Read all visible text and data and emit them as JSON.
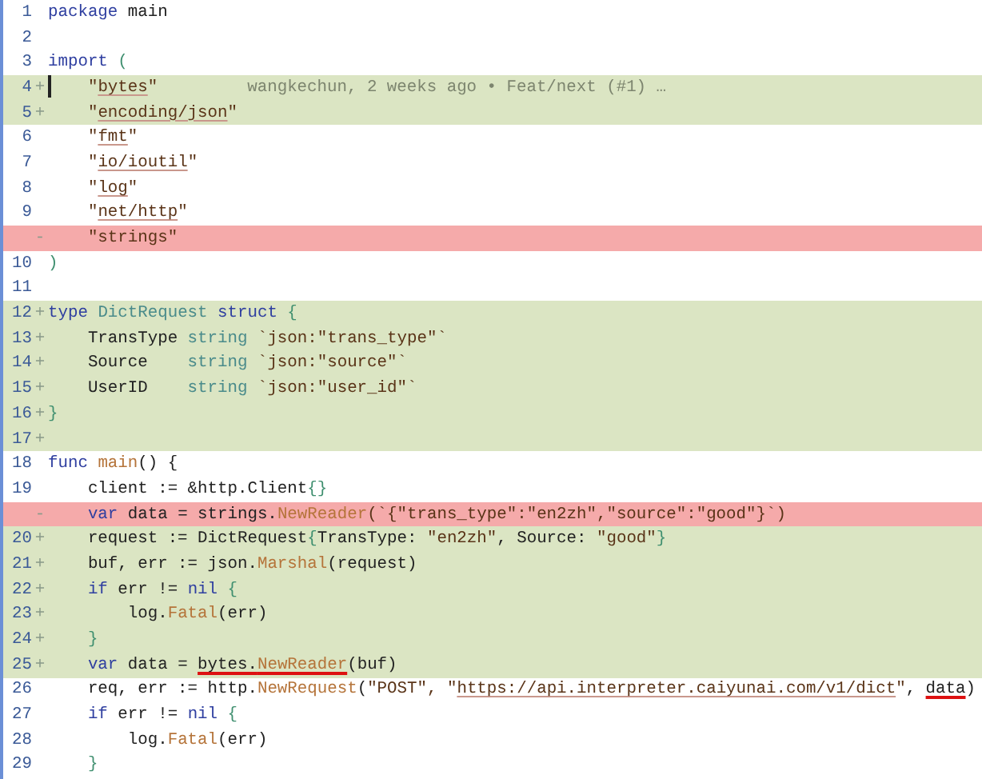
{
  "lines": [
    {
      "number": "1",
      "added": false,
      "removed": false,
      "code": [
        {
          "text": "package",
          "kind": "keyword"
        },
        {
          "text": " main",
          "kind": "plain"
        }
      ]
    },
    {
      "number": "2",
      "added": false,
      "removed": false
    },
    {
      "number": "3",
      "added": false,
      "removed": false,
      "code": [
        {
          "text": "import",
          "kind": "keyword"
        },
        {
          "text": " (",
          "kind": "punct"
        }
      ]
    },
    {
      "number": "4",
      "marker": "+",
      "added": true,
      "removed": false,
      "cursor": true,
      "code": [
        {
          "text": "    \"",
          "kind": "string"
        },
        {
          "text": "bytes",
          "kind": "link"
        },
        {
          "text": "\"",
          "kind": "string"
        }
      ],
      "blame": "wangkechun, 2 weeks ago • Feat/next (#1) …"
    },
    {
      "number": "5",
      "marker": "+",
      "added": true,
      "removed": false,
      "code": [
        {
          "text": "    \"",
          "kind": "string"
        },
        {
          "text": "encoding/json",
          "kind": "link"
        },
        {
          "text": "\"",
          "kind": "string"
        }
      ]
    },
    {
      "number": "6",
      "added": false,
      "removed": false,
      "code": [
        {
          "text": "    \"",
          "kind": "string"
        },
        {
          "text": "fmt",
          "kind": "link"
        },
        {
          "text": "\"",
          "kind": "string"
        }
      ]
    },
    {
      "number": "7",
      "added": false,
      "removed": false,
      "code": [
        {
          "text": "    \"",
          "kind": "string"
        },
        {
          "text": "io/ioutil",
          "kind": "link"
        },
        {
          "text": "\"",
          "kind": "string"
        }
      ]
    },
    {
      "number": "8",
      "added": false,
      "removed": false,
      "code": [
        {
          "text": "    \"",
          "kind": "string"
        },
        {
          "text": "log",
          "kind": "link"
        },
        {
          "text": "\"",
          "kind": "string"
        }
      ]
    },
    {
      "number": "9",
      "added": false,
      "removed": false,
      "code": [
        {
          "text": "    \"",
          "kind": "string"
        },
        {
          "text": "net/http",
          "kind": "link"
        },
        {
          "text": "\"",
          "kind": "string"
        }
      ]
    },
    {
      "marker": "-",
      "added": false,
      "removed": true,
      "code": [
        {
          "text": "    \"strings\"",
          "kind": "string"
        }
      ]
    },
    {
      "number": "10",
      "added": false,
      "removed": false,
      "code": [
        {
          "text": ")",
          "kind": "punct"
        }
      ]
    },
    {
      "number": "11",
      "added": false,
      "removed": false
    },
    {
      "number": "12",
      "marker": "+",
      "added": true,
      "removed": false,
      "code": [
        {
          "text": "type",
          "kind": "keyword"
        },
        {
          "text": " DictRequest",
          "kind": "type"
        },
        {
          "text": " struct",
          "kind": "keyword"
        },
        {
          "text": " {",
          "kind": "punct"
        }
      ]
    },
    {
      "number": "13",
      "marker": "+",
      "added": true,
      "removed": false,
      "code": [
        {
          "text": "    TransType ",
          "kind": "plain"
        },
        {
          "text": "string",
          "kind": "type"
        },
        {
          "text": " `json:\"trans_type\"`",
          "kind": "string"
        }
      ]
    },
    {
      "number": "14",
      "marker": "+",
      "added": true,
      "removed": false,
      "code": [
        {
          "text": "    Source    ",
          "kind": "plain"
        },
        {
          "text": "string",
          "kind": "type"
        },
        {
          "text": " `json:\"source\"`",
          "kind": "string"
        }
      ]
    },
    {
      "number": "15",
      "marker": "+",
      "added": true,
      "removed": false,
      "code": [
        {
          "text": "    UserID    ",
          "kind": "plain"
        },
        {
          "text": "string",
          "kind": "type"
        },
        {
          "text": " `json:\"user_id\"`",
          "kind": "string"
        }
      ]
    },
    {
      "number": "16",
      "marker": "+",
      "added": true,
      "removed": false,
      "code": [
        {
          "text": "}",
          "kind": "punct"
        }
      ]
    },
    {
      "number": "17",
      "marker": "+",
      "added": true,
      "removed": false
    },
    {
      "number": "18",
      "added": false,
      "removed": false,
      "code": [
        {
          "text": "func",
          "kind": "keyword"
        },
        {
          "text": " main",
          "kind": "func"
        },
        {
          "text": "() {",
          "kind": "plain"
        }
      ]
    },
    {
      "number": "19",
      "added": false,
      "removed": false,
      "code": [
        {
          "text": "    client := &http.Client",
          "kind": "plain"
        },
        {
          "text": "{}",
          "kind": "punct"
        }
      ]
    },
    {
      "marker": "-",
      "added": false,
      "removed": true,
      "code": [
        {
          "text": "    var",
          "kind": "keyword"
        },
        {
          "text": " data = strings.",
          "kind": "plain"
        },
        {
          "text": "NewReader",
          "kind": "func"
        },
        {
          "text": "(`{\"trans_type\":\"en2zh\",\"source\":\"good\"}`)",
          "kind": "string"
        }
      ]
    },
    {
      "number": "20",
      "marker": "+",
      "added": true,
      "removed": false,
      "code": [
        {
          "text": "    request := DictRequest",
          "kind": "plain"
        },
        {
          "text": "{",
          "kind": "punct"
        },
        {
          "text": "TransType: ",
          "kind": "plain"
        },
        {
          "text": "\"en2zh\"",
          "kind": "string"
        },
        {
          "text": ", Source: ",
          "kind": "plain"
        },
        {
          "text": "\"good\"",
          "kind": "string"
        },
        {
          "text": "}",
          "kind": "punct"
        }
      ]
    },
    {
      "number": "21",
      "marker": "+",
      "added": true,
      "removed": false,
      "code": [
        {
          "text": "    buf, err := json.",
          "kind": "plain"
        },
        {
          "text": "Marshal",
          "kind": "func"
        },
        {
          "text": "(request)",
          "kind": "plain"
        }
      ]
    },
    {
      "number": "22",
      "marker": "+",
      "added": true,
      "removed": false,
      "code": [
        {
          "text": "    if",
          "kind": "keyword"
        },
        {
          "text": " err != ",
          "kind": "plain"
        },
        {
          "text": "nil",
          "kind": "keyword"
        },
        {
          "text": " {",
          "kind": "punct"
        }
      ]
    },
    {
      "number": "23",
      "marker": "+",
      "added": true,
      "removed": false,
      "code": [
        {
          "text": "        log.",
          "kind": "plain"
        },
        {
          "text": "Fatal",
          "kind": "func"
        },
        {
          "text": "(err)",
          "kind": "plain"
        }
      ]
    },
    {
      "number": "24",
      "marker": "+",
      "added": true,
      "removed": false,
      "code": [
        {
          "text": "    }",
          "kind": "punct"
        }
      ]
    },
    {
      "number": "25",
      "marker": "+",
      "added": true,
      "removed": false,
      "code": [
        {
          "text": "    var",
          "kind": "keyword"
        },
        {
          "text": " data = ",
          "kind": "plain"
        },
        {
          "text": "bytes.",
          "kind": "marked"
        },
        {
          "text": "NewReader",
          "kind": "marked-func"
        },
        {
          "text": "(buf)",
          "kind": "plain"
        }
      ]
    },
    {
      "number": "26",
      "added": false,
      "removed": false,
      "code": [
        {
          "text": "    req, err := http.",
          "kind": "plain"
        },
        {
          "text": "NewRequest",
          "kind": "func"
        },
        {
          "text": "(",
          "kind": "plain"
        },
        {
          "text": "\"POST\"",
          "kind": "string"
        },
        {
          "text": ", \"",
          "kind": "string"
        },
        {
          "text": "https://api.interpreter.caiyunai.com/v1/dict",
          "kind": "link"
        },
        {
          "text": "\"",
          "kind": "string"
        },
        {
          "text": ", ",
          "kind": "plain"
        },
        {
          "text": "data",
          "kind": "marked"
        },
        {
          "text": ")",
          "kind": "plain"
        }
      ]
    },
    {
      "number": "27",
      "added": false,
      "removed": false,
      "code": [
        {
          "text": "    if",
          "kind": "keyword"
        },
        {
          "text": " err != ",
          "kind": "plain"
        },
        {
          "text": "nil",
          "kind": "keyword"
        },
        {
          "text": " {",
          "kind": "punct"
        }
      ]
    },
    {
      "number": "28",
      "added": false,
      "removed": false,
      "code": [
        {
          "text": "        log.",
          "kind": "plain"
        },
        {
          "text": "Fatal",
          "kind": "func"
        },
        {
          "text": "(err)",
          "kind": "plain"
        }
      ]
    },
    {
      "number": "29",
      "added": false,
      "removed": false,
      "code": [
        {
          "text": "    }",
          "kind": "punct"
        }
      ]
    }
  ]
}
